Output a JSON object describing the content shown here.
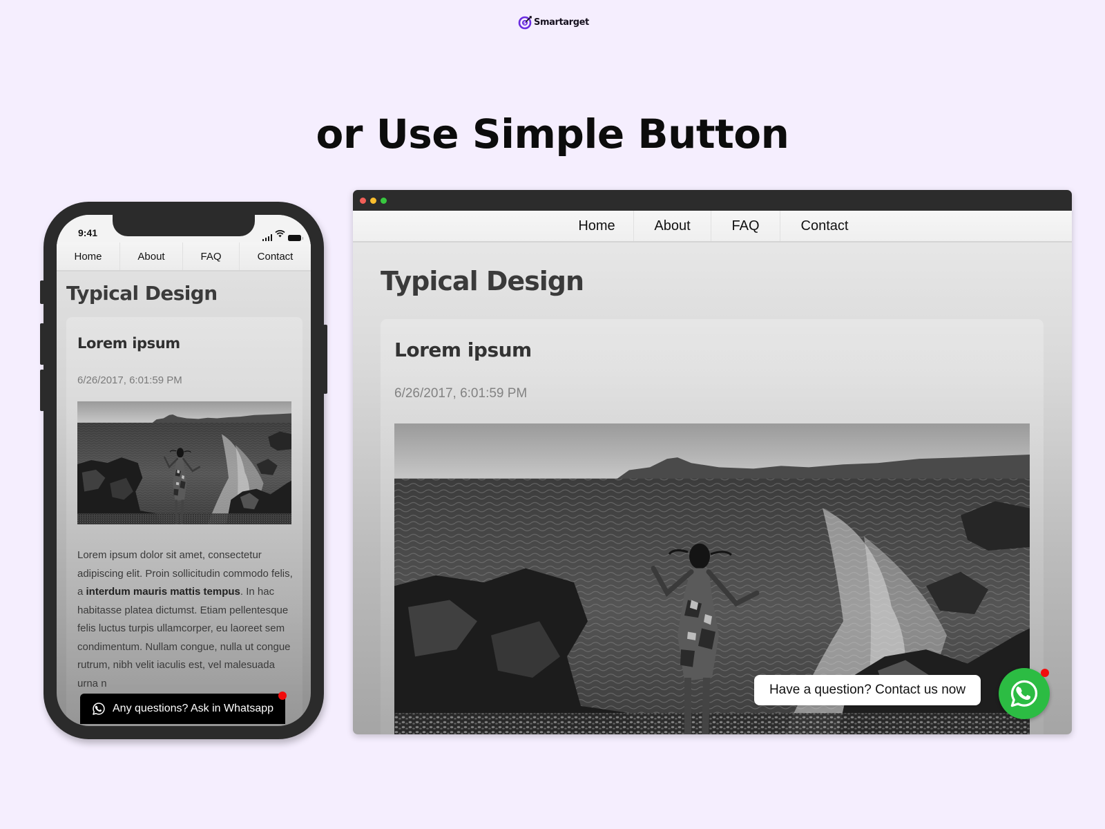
{
  "brand": {
    "name": "Smartarget",
    "logo_icon": "target-icon",
    "accent": "#6a2ce0"
  },
  "headline": "or Use Simple Button",
  "colors": {
    "background": "#f5eefe",
    "whatsapp_green": "#2cbc43",
    "notification_red": "#f20c0c",
    "frame_dark": "#2b2b2b"
  },
  "mobile": {
    "status_time": "9:41",
    "status_icons": [
      "signal-icon",
      "wifi-icon",
      "battery-icon"
    ],
    "nav": [
      {
        "label": "Home"
      },
      {
        "label": "About"
      },
      {
        "label": "FAQ"
      },
      {
        "label": "Contact"
      }
    ],
    "page_title": "Typical Design",
    "card": {
      "title": "Lorem ipsum",
      "date": "6/26/2017, 6:01:59 PM",
      "image_alt": "Black and white photo of a woman on rocky seashore with crashing waves",
      "body_pre": "Lorem ipsum dolor sit amet, consectetur adipiscing elit. Proin sollicitudin commodo felis, a ",
      "body_bold": "interdum mauris mattis tempus",
      "body_post": ". In hac habitasse platea dictumst. Etiam pellentesque felis luctus turpis ullamcorper, eu laoreet sem condimentum. Nullam congue, nulla ut congue rutrum, nibh velit iaculis est, vel malesuada urna n"
    },
    "cta": {
      "label": "Any questions? Ask in Whatsapp",
      "icon": "whatsapp-icon"
    }
  },
  "desktop": {
    "window_controls": [
      "close",
      "minimize",
      "maximize"
    ],
    "nav": [
      {
        "label": "Home"
      },
      {
        "label": "About"
      },
      {
        "label": "FAQ"
      },
      {
        "label": "Contact"
      }
    ],
    "page_title": "Typical Design",
    "card": {
      "title": "Lorem ipsum",
      "date": "6/26/2017, 6:01:59 PM",
      "image_alt": "Black and white photo of a woman on rocky seashore with crashing waves"
    },
    "contact_bubble": "Have a question? Contact us now",
    "whatsapp_button": {
      "icon": "whatsapp-icon",
      "has_notification": true
    }
  }
}
